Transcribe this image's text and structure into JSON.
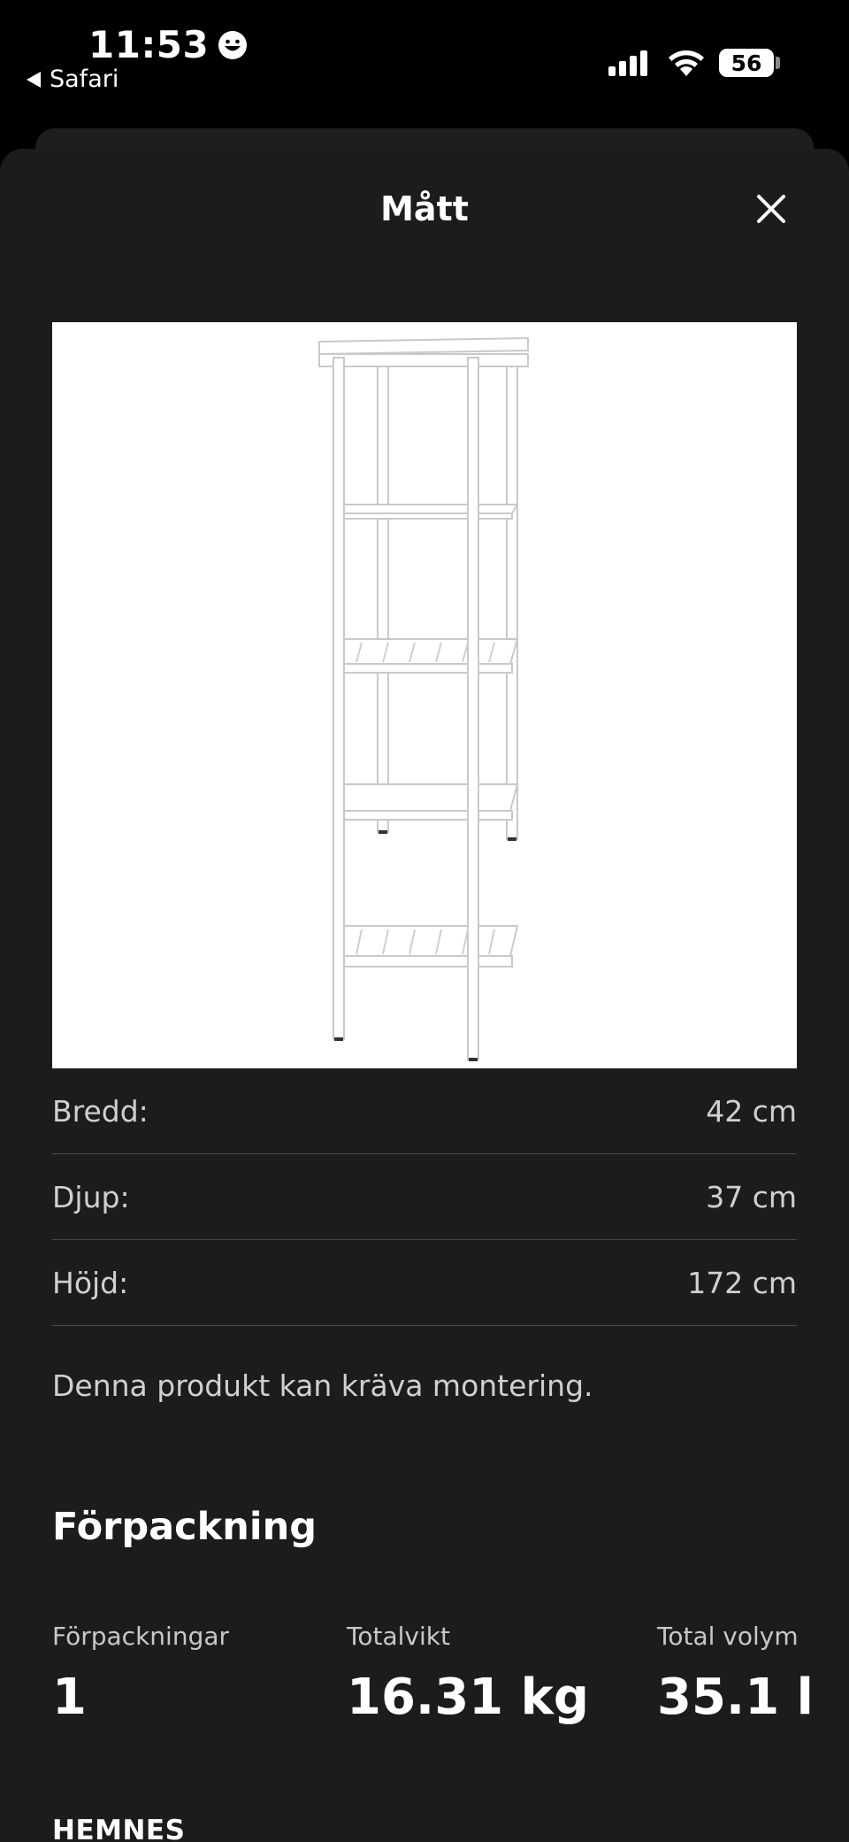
{
  "status_bar": {
    "time": "11:53",
    "back_app": "Safari",
    "battery": "56"
  },
  "modal": {
    "title": "Mått",
    "close_icon": "close-icon"
  },
  "product_image": {
    "icon": "white-shelving-unit-photo"
  },
  "dimensions": [
    {
      "label": "Bredd:",
      "value": "42 cm"
    },
    {
      "label": "Djup:",
      "value": "37 cm"
    },
    {
      "label": "Höjd:",
      "value": "172 cm"
    }
  ],
  "assembly_note": "Denna produkt kan kräva montering.",
  "packaging": {
    "title": "Förpackning",
    "columns": [
      {
        "label": "Förpackningar",
        "value": "1"
      },
      {
        "label": "Totalvikt",
        "value": "16.31 kg"
      },
      {
        "label": "Total volym",
        "value": "35.1 l"
      }
    ]
  },
  "series": "HEMNES",
  "colors": {
    "sheet": "#1c1c1e",
    "divider": "#4a4a4c",
    "text_secondary": "#d0d0d2"
  }
}
